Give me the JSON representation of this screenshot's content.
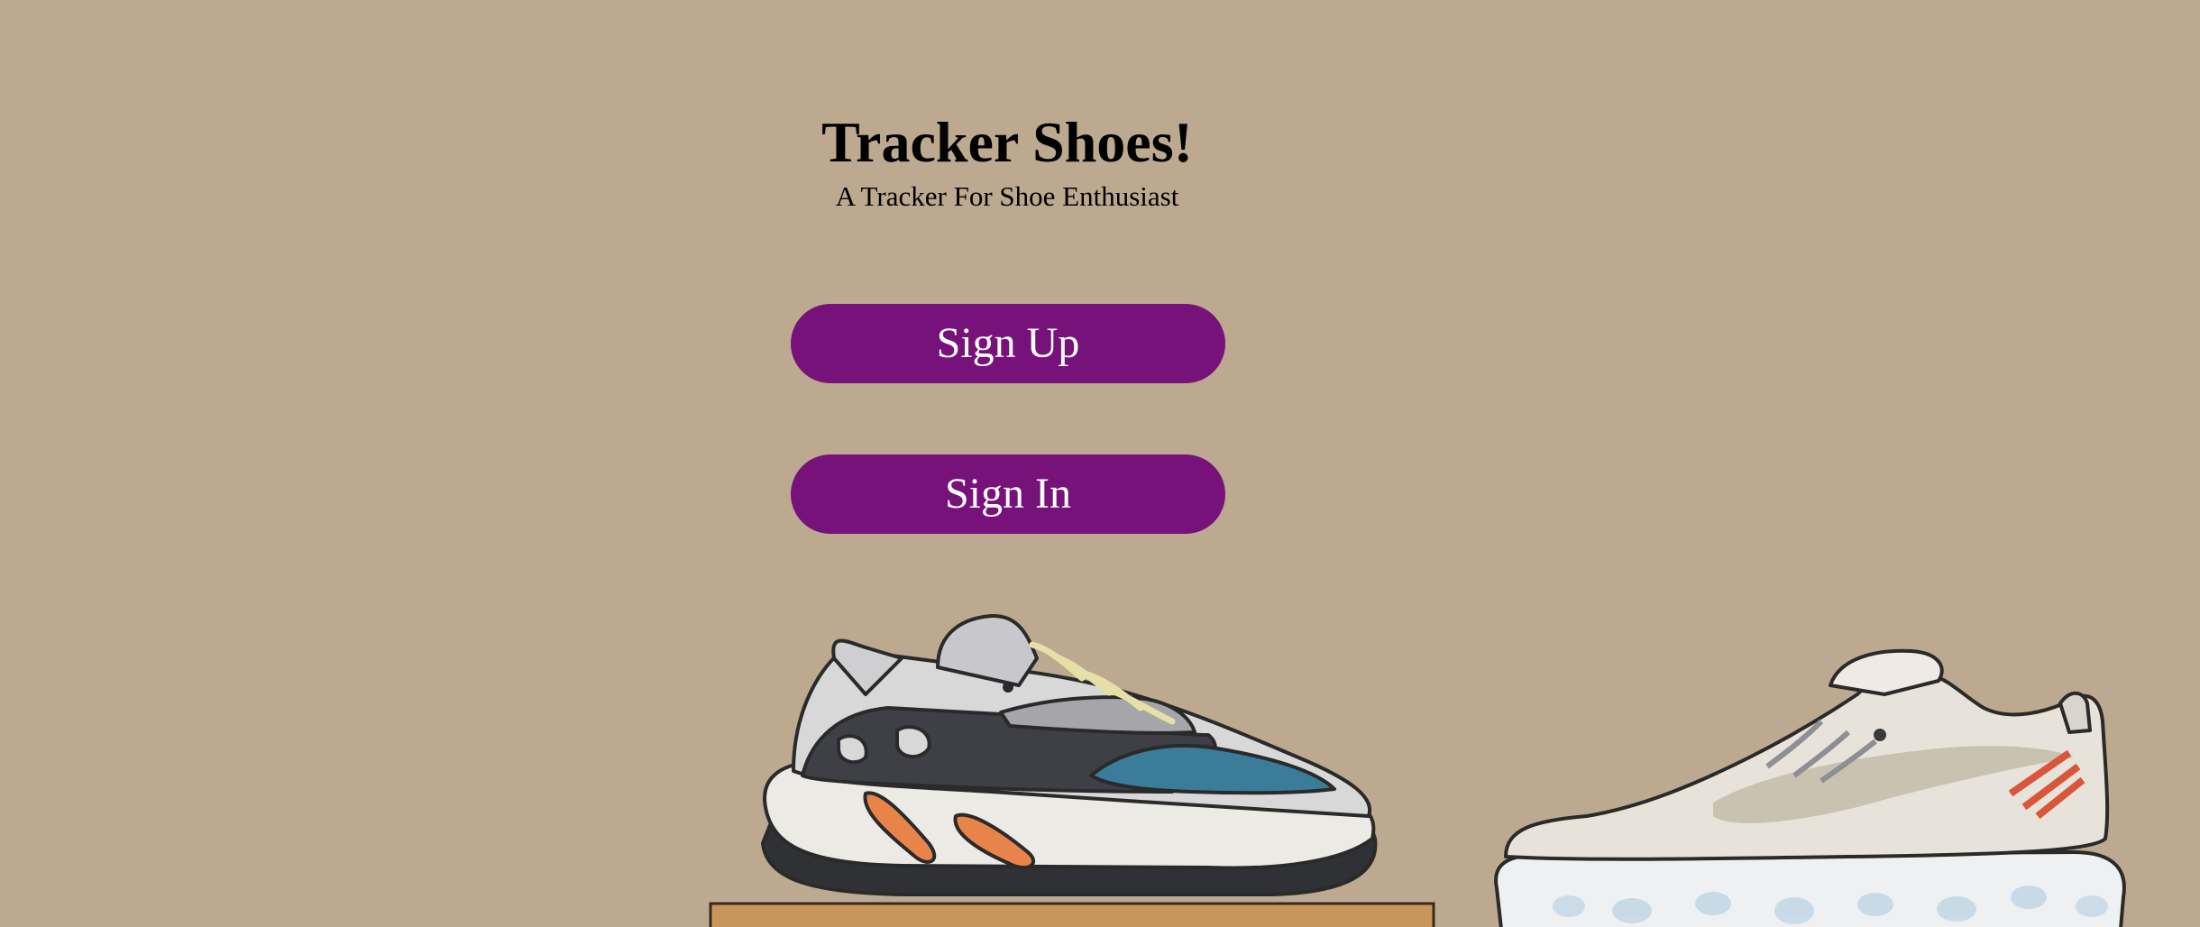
{
  "colors": {
    "background": "#bca98f",
    "button_fill": "#77127a",
    "button_text": "#ffffff",
    "text": "#000000"
  },
  "header": {
    "title": "Tracker Shoes!",
    "subtitle": "A Tracker For Shoe Enthusiast"
  },
  "actions": {
    "sign_up_label": "Sign Up",
    "sign_in_label": "Sign In"
  },
  "illustration": {
    "items": [
      "sneaker-illustration-left",
      "sneaker-illustration-right",
      "display-box"
    ]
  }
}
